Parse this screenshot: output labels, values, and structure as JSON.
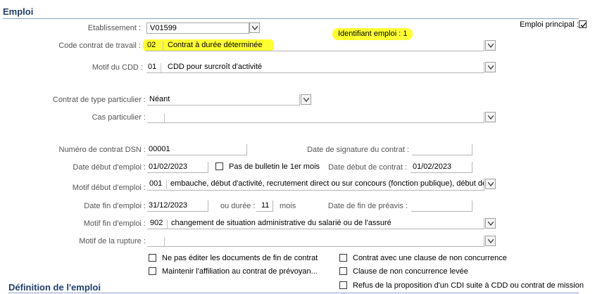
{
  "sections": {
    "emploi": "Emploi",
    "definition": "Définition de l'emploi"
  },
  "header": {
    "identifiant_label": "Identifiant emploi : 1",
    "emploi_principal_label": "Emploi principal :",
    "emploi_principal_checked": true
  },
  "etablissement": {
    "label": "Etablissement :",
    "value": "V01599"
  },
  "code_contrat": {
    "label": "Code contrat de travail :",
    "code": "02",
    "text": "Contrat à durée déterminée"
  },
  "motif_cdd": {
    "label": "Motif du CDD :",
    "code": "01",
    "text": "CDD pour surcroît d'activité"
  },
  "contrat_particulier": {
    "label": "Contrat de type particulier :",
    "value": "Néant"
  },
  "cas_particulier": {
    "label": "Cas particulier :",
    "value": ""
  },
  "numero_dsn": {
    "label": "Numéro de contrat DSN :",
    "value": "00001"
  },
  "date_signature": {
    "label": "Date de signature du contrat :",
    "value": ""
  },
  "date_debut_emploi": {
    "label": "Date début d'emploi :",
    "value": "01/02/2023"
  },
  "pas_bulletin": {
    "label": "Pas de bulletin le 1er mois",
    "checked": false
  },
  "date_debut_contrat": {
    "label": "Date début de contrat :",
    "value": "01/02/2023"
  },
  "motif_debut": {
    "label": "Motif début d'emploi :",
    "code": "001",
    "text": "embauche, début d'activité, recrutement direct ou sur concours (fonction publique), début de c"
  },
  "date_fin_emploi": {
    "label": "Date fin d'emploi :",
    "value": "31/12/2023"
  },
  "duree": {
    "label": "ou durée :",
    "value": "11",
    "unit": "mois"
  },
  "date_fin_preavis": {
    "label": "Date de fin de préavis :",
    "value": ""
  },
  "motif_fin": {
    "label": "Motif fin d'emploi :",
    "code": "902",
    "text": "changement de situation administrative du salarié ou de l'assuré"
  },
  "motif_rupture": {
    "label": "Motif de la rupture :",
    "value": ""
  },
  "checkboxes": [
    {
      "label": "Ne pas éditer les documents de fin de contrat",
      "checked": false
    },
    {
      "label": "Maintenir l'affiliation au contrat de prévoyan...",
      "checked": false
    },
    {
      "label": "Contrat avec une clause de non concurrence",
      "checked": false
    },
    {
      "label": "Clause de non concurrence levée",
      "checked": false
    },
    {
      "label": "Refus de la proposition d'un CDI suite à CDD ou contrat de mission",
      "checked": false
    }
  ],
  "colors": {
    "highlight": "#ffff33",
    "section_title": "#1f3f6b"
  }
}
